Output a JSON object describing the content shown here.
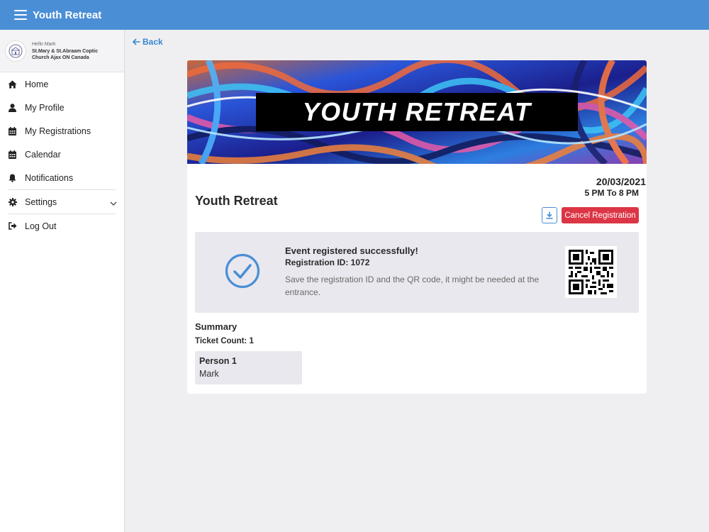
{
  "app": {
    "title": "Youth Retreat",
    "menu_icon": "hamburger-icon"
  },
  "user": {
    "greeting": "Hello Mark",
    "church_line1": "St.Mary & St.Abraam Coptic",
    "church_line2": "Church Ajax ON Canada"
  },
  "sidebar": {
    "items": [
      {
        "label": "Home",
        "icon": "home-icon"
      },
      {
        "label": "My Profile",
        "icon": "user-icon"
      },
      {
        "label": "My Registrations",
        "icon": "calendar-grid-icon"
      },
      {
        "label": "Calendar",
        "icon": "calendar-icon"
      },
      {
        "label": "Notifications",
        "icon": "bell-icon"
      },
      {
        "label": "Settings",
        "icon": "gear-icon"
      },
      {
        "label": "Log Out",
        "icon": "logout-icon"
      }
    ]
  },
  "nav": {
    "back_label": "Back"
  },
  "event": {
    "banner_text": "YOUTH RETREAT",
    "title": "Youth Retreat",
    "date": "20/03/2021",
    "time": "5 PM To 8 PM",
    "cancel_label": "Cancel Registration"
  },
  "registration": {
    "success_title": "Event registered successfully!",
    "id_label": "Registration ID: 1072",
    "note": "Save the registration ID and the QR code, it might be needed at the entrance."
  },
  "summary": {
    "title": "Summary",
    "ticket_count": "Ticket Count: 1",
    "persons": [
      {
        "title": "Person 1",
        "name": "Mark"
      }
    ]
  },
  "colors": {
    "topbar": "#4a8fd6",
    "accent": "#3b86d1",
    "danger": "#dc3545",
    "panel": "#e9e8ee"
  }
}
